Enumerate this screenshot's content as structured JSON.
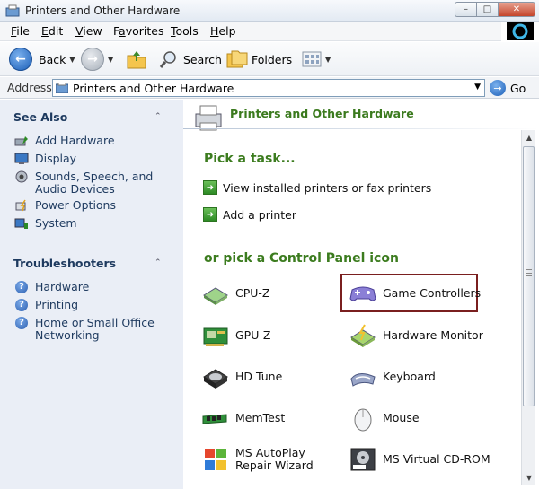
{
  "window": {
    "title": "Printers and Other Hardware"
  },
  "window_buttons": {
    "minimize": "–",
    "maximize": "□",
    "close": "✕"
  },
  "menu": [
    {
      "label": "File",
      "mnemonic": "F",
      "rest": "ile"
    },
    {
      "label": "Edit",
      "mnemonic": "E",
      "rest": "dit"
    },
    {
      "label": "View",
      "mnemonic": "V",
      "rest": "iew"
    },
    {
      "label": "Favorites",
      "mnemonic": "",
      "pre": "F",
      "mid": "a",
      "post": "vorites"
    },
    {
      "label": "Tools",
      "mnemonic": "T",
      "rest": "ools"
    },
    {
      "label": "Help",
      "mnemonic": "H",
      "rest": "elp"
    }
  ],
  "toolbar": {
    "back": "Back",
    "search": "Search",
    "folders": "Folders"
  },
  "address": {
    "label": "Address",
    "value": "Printers and Other Hardware",
    "go": "Go"
  },
  "see_also": {
    "title": "See Also",
    "items": [
      {
        "label": "Add Hardware",
        "icon": "add-hardware-icon"
      },
      {
        "label": "Display",
        "icon": "display-icon"
      },
      {
        "label": "Sounds, Speech, and Audio Devices",
        "icon": "sounds-icon"
      },
      {
        "label": "Power Options",
        "icon": "power-options-icon"
      },
      {
        "label": "System",
        "icon": "system-icon"
      }
    ]
  },
  "troubleshooters": {
    "title": "Troubleshooters",
    "items": [
      {
        "label": "Hardware"
      },
      {
        "label": "Printing"
      },
      {
        "label": "Home or Small Office Networking"
      }
    ]
  },
  "main": {
    "title": "Printers and Other Hardware",
    "pick_task": "Pick a task...",
    "tasks": [
      {
        "label": "View installed printers or fax printers"
      },
      {
        "label": "Add a printer"
      }
    ],
    "pick_icon": "or pick a Control Panel icon",
    "icons": [
      {
        "label": "CPU-Z",
        "icon": "cpu-z-icon"
      },
      {
        "label": "Game Controllers",
        "icon": "game-controller-icon",
        "selected": true
      },
      {
        "label": "GPU-Z",
        "icon": "gpu-z-icon"
      },
      {
        "label": "Hardware Monitor",
        "icon": "hardware-monitor-icon"
      },
      {
        "label": "HD Tune",
        "icon": "hd-tune-icon"
      },
      {
        "label": "Keyboard",
        "icon": "keyboard-icon"
      },
      {
        "label": "MemTest",
        "icon": "memtest-icon"
      },
      {
        "label": "Mouse",
        "icon": "mouse-icon"
      },
      {
        "label": "MS AutoPlay Repair Wizard",
        "icon": "autoplay-repair-icon"
      },
      {
        "label": "MS Virtual CD-ROM",
        "icon": "virtual-cdrom-icon"
      }
    ]
  },
  "colors": {
    "accent_green": "#3c7c1f",
    "pane_bg": "#eaeef6",
    "selection_border": "#7a1f1f",
    "link_blue": "#1e3a5f"
  }
}
